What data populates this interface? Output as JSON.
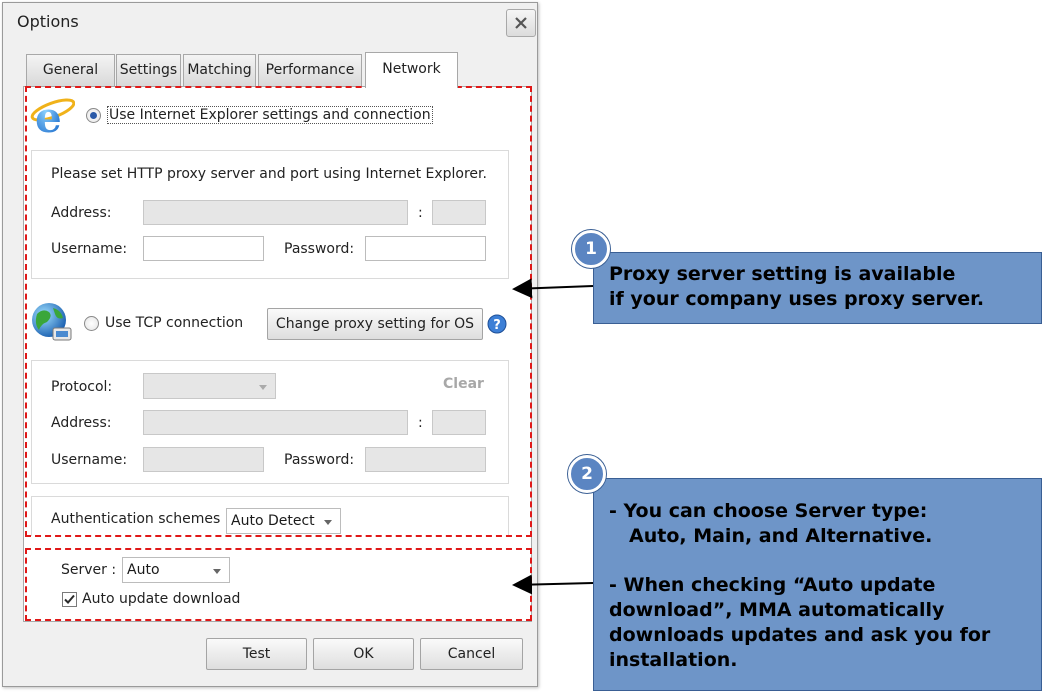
{
  "dialog": {
    "title": "Options",
    "close_icon": "close-icon"
  },
  "tabs": [
    {
      "label": "General",
      "active": false
    },
    {
      "label": "Settings",
      "active": false
    },
    {
      "label": "Matching",
      "active": false
    },
    {
      "label": "Performance",
      "active": false
    },
    {
      "label": "Network",
      "active": true
    }
  ],
  "ie_section": {
    "icon": "internet-explorer-icon",
    "radio_label": "Use Internet Explorer settings and connection",
    "selected": true,
    "note": "Please set HTTP proxy server and port using Internet Explorer.",
    "address_label": "Address:",
    "port_separator": ":",
    "username_label": "Username:",
    "password_label": "Password:",
    "address_value": "",
    "port_value": "",
    "username_value": "",
    "password_value": ""
  },
  "tcp_section": {
    "icon": "globe-network-icon",
    "radio_label": "Use TCP connection",
    "selected": false,
    "change_proxy_button": "Change proxy setting for OS",
    "help_icon": "help-icon",
    "protocol_label": "Protocol:",
    "protocol_value": "",
    "clear_label": "Clear",
    "address_label": "Address:",
    "port_separator": ":",
    "username_label": "Username:",
    "password_label": "Password:"
  },
  "auth": {
    "label": "Authentication schemes :",
    "value": "Auto Detect"
  },
  "server": {
    "label": "Server :",
    "value": "Auto",
    "auto_update_label": "Auto update download",
    "auto_update_checked": true
  },
  "buttons": {
    "test": "Test",
    "ok": "OK",
    "cancel": "Cancel"
  },
  "callouts": [
    {
      "number": "1",
      "lines": [
        "Proxy server setting is available",
        "if your company uses proxy server."
      ]
    },
    {
      "number": "2",
      "lines": [
        "- You can choose Server type:",
        "Auto, Main, and Alternative.",
        "",
        "- When checking “Auto update",
        "download”,  MMA automatically",
        "downloads updates and ask you for",
        "installation."
      ]
    }
  ],
  "colors": {
    "callout_fill": "#6e95c8",
    "badge_fill": "#5b85c2",
    "highlight_dash": "#e01818"
  }
}
